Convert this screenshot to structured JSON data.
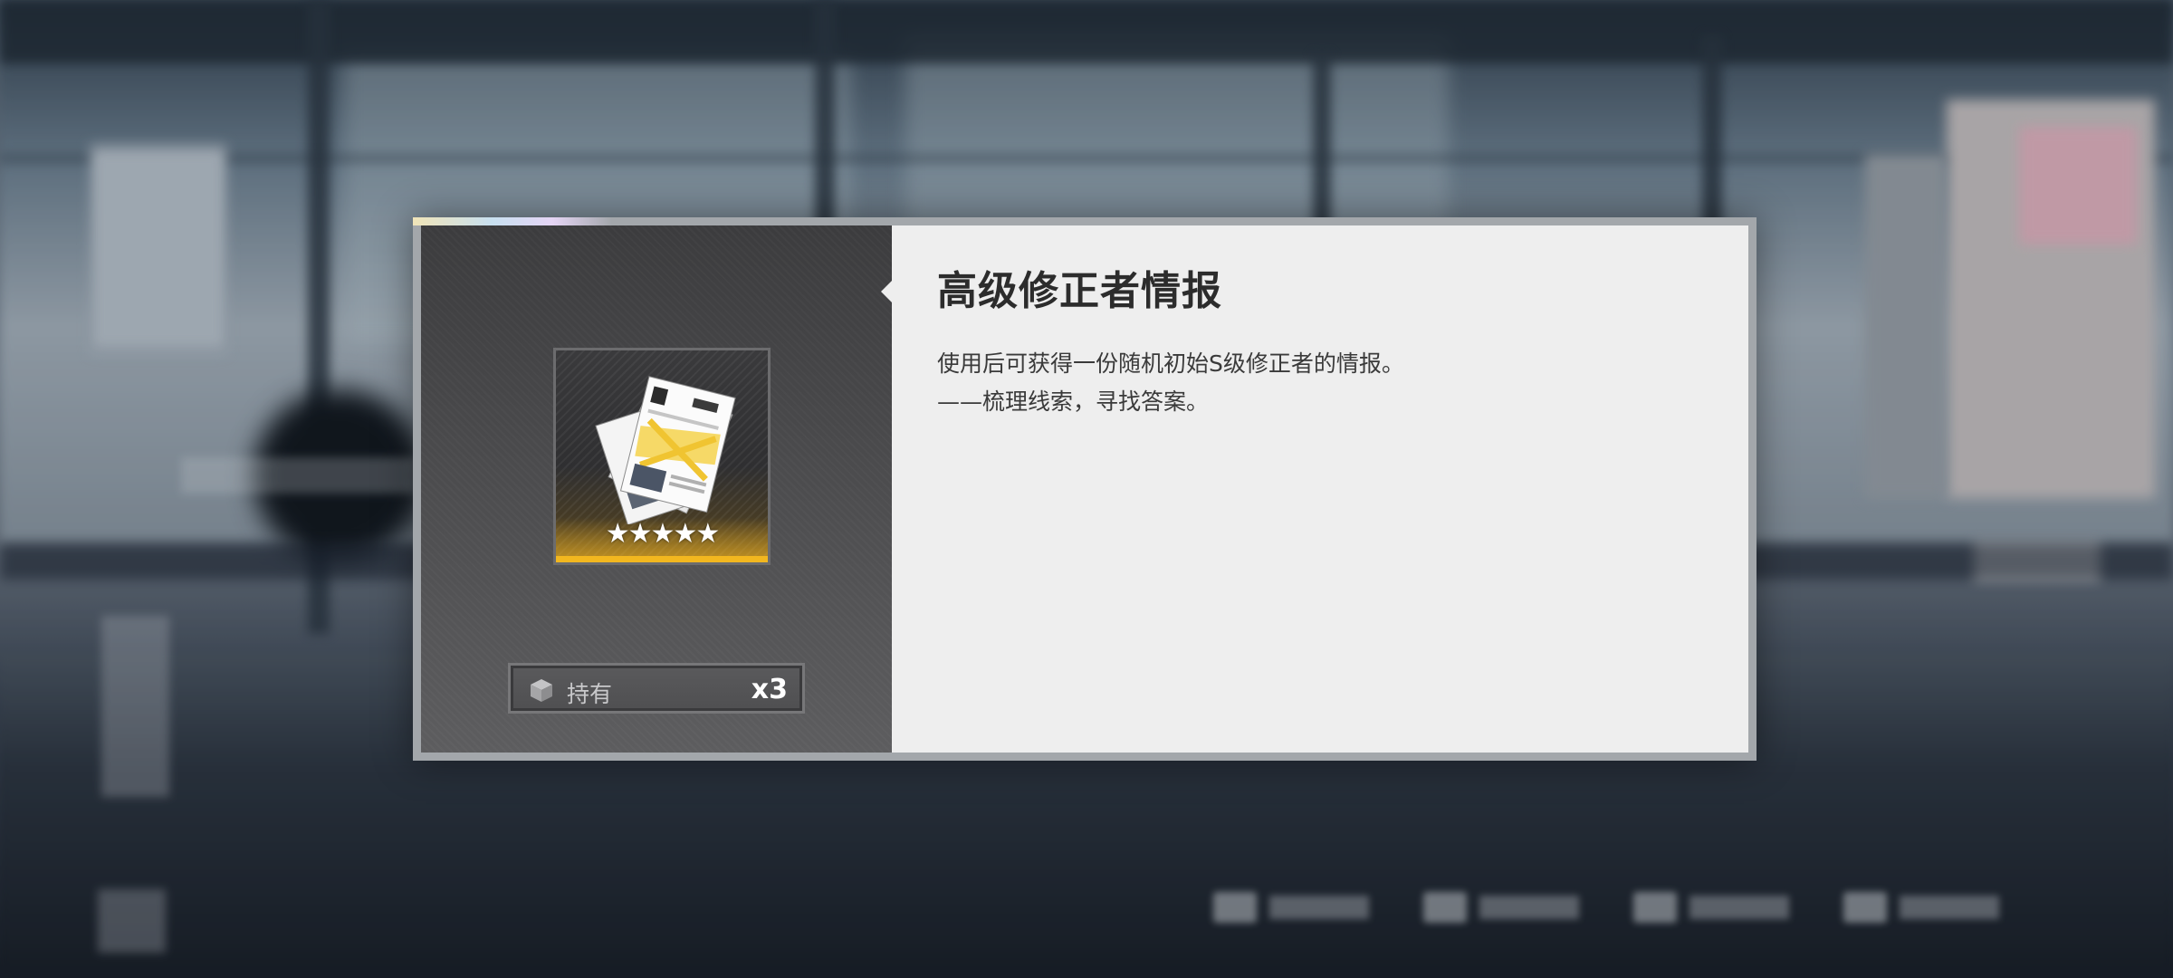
{
  "item_detail": {
    "title": "高级修正者情报",
    "description_lines": [
      "使用后可获得一份随机初始S级修正者的情报。",
      "——梳理线索，寻找答案。"
    ],
    "rarity_stars": "★★★★★",
    "rarity_star_count": 5,
    "owned_label": "持有",
    "owned_count": "x3",
    "icon": "intel-documents-icon",
    "colors": {
      "rarity_gold": "#f2b71f",
      "panel_dark": "#474749",
      "panel_light": "#eeeeee"
    }
  }
}
